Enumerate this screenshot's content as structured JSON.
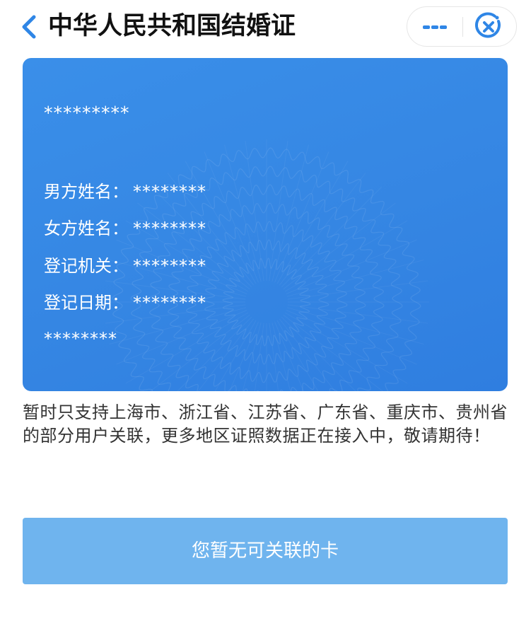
{
  "header": {
    "title": "中华人民共和国结婚证",
    "back_icon": "chevron-left-icon",
    "more_icon": "more-dots-icon",
    "close_icon": "close-circle-icon"
  },
  "card": {
    "number": "*********",
    "fields": [
      {
        "label": "男方姓名：",
        "value": "********"
      },
      {
        "label": "女方姓名：",
        "value": "********"
      },
      {
        "label": "登记机关：",
        "value": "********"
      },
      {
        "label": "登记日期：",
        "value": "********"
      }
    ],
    "footer": "********"
  },
  "notice": "暂时只支持上海市、浙江省、江苏省、广东省、重庆市、贵州省的部分用户关联，更多地区证照数据正在接入中，敬请期待！",
  "button": {
    "label": "您暂无可关联的卡"
  },
  "colors": {
    "accent": "#2f86e6",
    "card": "#3586e3",
    "button": "#6fb4ee"
  }
}
